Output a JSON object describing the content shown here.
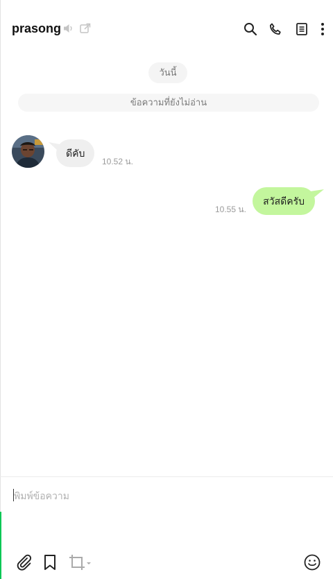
{
  "header": {
    "contact_name": "prasong",
    "icons": [
      "speaker-muted-icon",
      "external-window-icon",
      "search-icon",
      "phone-icon",
      "notes-icon",
      "more-menu-icon"
    ]
  },
  "conversation": {
    "date_label": "วันนี้",
    "unread_divider": "ข้อความที่ยังไม่อ่าน",
    "messages": [
      {
        "direction": "incoming",
        "text": "ดีคับ",
        "time": "10.52 น."
      },
      {
        "direction": "outgoing",
        "text": "สวัสดีครับ",
        "time": "10.55 น."
      }
    ]
  },
  "composer": {
    "placeholder": "พิมพ์ข้อความ",
    "value": "",
    "toolbar_icons": [
      "attach-file-icon",
      "bookmark-icon",
      "screen-capture-icon",
      "emoji-icon"
    ]
  },
  "colors": {
    "outgoing_bubble": "#c3f69d",
    "incoming_bubble": "#efefef",
    "accent": "#06c755",
    "pill_background": "#f4f4f4"
  }
}
